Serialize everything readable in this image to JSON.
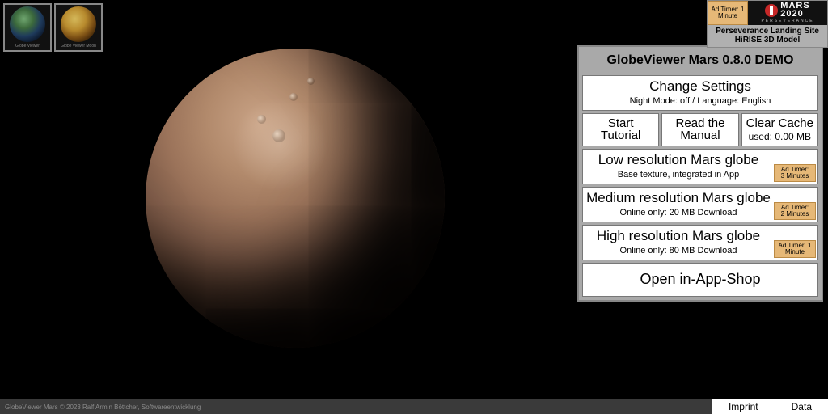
{
  "thumbs": {
    "earth_caption": "Globe Viewer",
    "moon_caption": "Globe Viewer Moon"
  },
  "badge": {
    "ad_timer_label": "Ad Timer: 1",
    "ad_timer_unit": "Minute",
    "logo_top": "MARS",
    "logo_bottom": "2020",
    "logo_sub": "PERSEVERANCE",
    "line1": "Perseverance Landing Site",
    "line2": "HiRISE 3D Model"
  },
  "panel": {
    "title": "GlobeViewer Mars 0.8.0 DEMO",
    "settings": {
      "label": "Change Settings",
      "sub": "Night Mode: off / Language: English"
    },
    "tutorial": {
      "l1": "Start",
      "l2": "Tutorial"
    },
    "manual": {
      "l1": "Read the",
      "l2": "Manual"
    },
    "cache": {
      "label": "Clear Cache",
      "sub": "used: 0.00 MB"
    },
    "low": {
      "label": "Low resolution Mars globe",
      "sub": "Base texture, integrated in App",
      "ad_l1": "Ad Timer:",
      "ad_l2": "3 Minutes"
    },
    "med": {
      "label": "Medium resolution Mars globe",
      "sub": "Online only: 20 MB Download",
      "ad_l1": "Ad Timer:",
      "ad_l2": "2 Minutes"
    },
    "high": {
      "label": "High resolution Mars globe",
      "sub": "Online only: 80 MB Download",
      "ad_l1": "Ad Timer: 1",
      "ad_l2": "Minute"
    },
    "shop": {
      "label": "Open in-App-Shop"
    }
  },
  "footer": {
    "copy": "GlobeViewer Mars © 2023 Ralf Armin Böttcher, Softwareentwicklung",
    "imprint": "Imprint",
    "data": "Data"
  }
}
